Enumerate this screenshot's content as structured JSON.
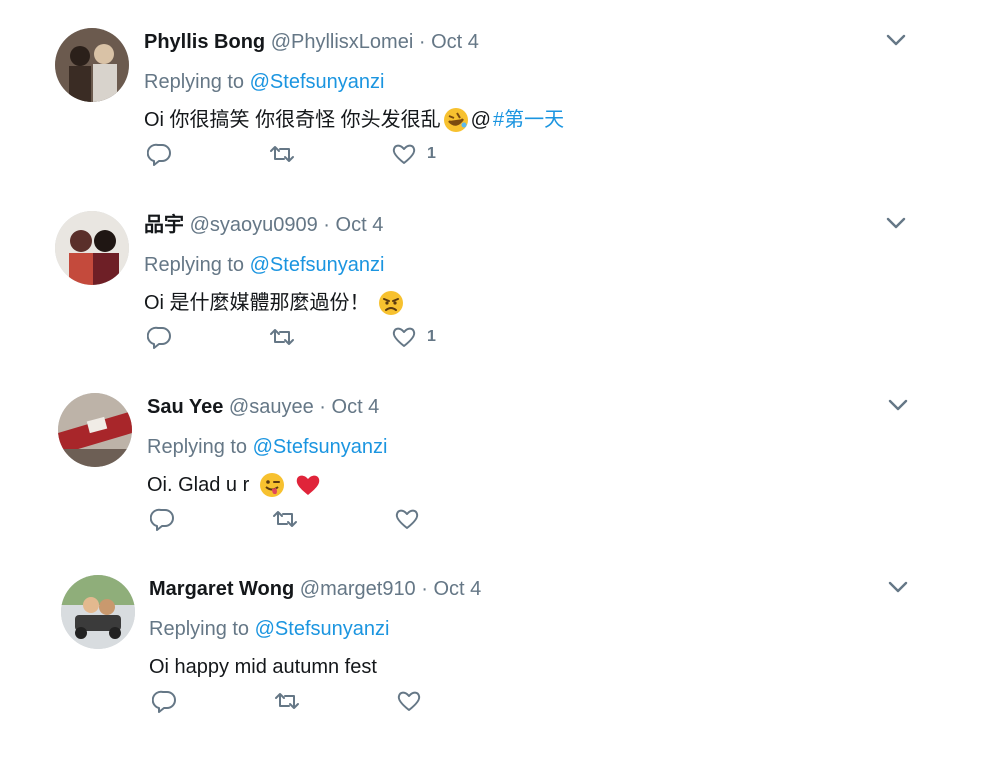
{
  "tweets": [
    {
      "name": "Phyllis Bong",
      "handle": "@PhyllisxLomei",
      "dot": "·",
      "date": "Oct 4",
      "replying_prefix": "Replying to ",
      "replying_to": "@Stefsunyanzi",
      "text": "Oi 你很搞笑 你很奇怪 你头发很乱",
      "text_after_emoji": "@",
      "hashtag": "#第一天",
      "emoji": "rolling-on-floor-laughing",
      "like_count": "1"
    },
    {
      "name": "品宇",
      "handle": "@syaoyu0909",
      "dot": "·",
      "date": "Oct 4",
      "replying_prefix": "Replying to ",
      "replying_to": "@Stefsunyanzi",
      "text": "Oi 是什麼媒體那麼過份！",
      "emoji": "angry-face",
      "like_count": "1"
    },
    {
      "name": "Sau Yee",
      "handle": "@sauyee",
      "dot": "·",
      "date": "Oct 4",
      "replying_prefix": "Replying to ",
      "replying_to": "@Stefsunyanzi",
      "text": "Oi. Glad u r",
      "emoji": "winking-face-with-tongue",
      "emoji2": "red-heart",
      "like_count": ""
    },
    {
      "name": "Margaret Wong",
      "handle": "@marget910",
      "dot": "·",
      "date": "Oct 4",
      "replying_prefix": "Replying to ",
      "replying_to": "@Stefsunyanzi",
      "text": "Oi happy mid autumn fest",
      "like_count": ""
    }
  ],
  "colors": {
    "link": "#1b95e0",
    "muted": "#657786",
    "text": "#14171a"
  }
}
